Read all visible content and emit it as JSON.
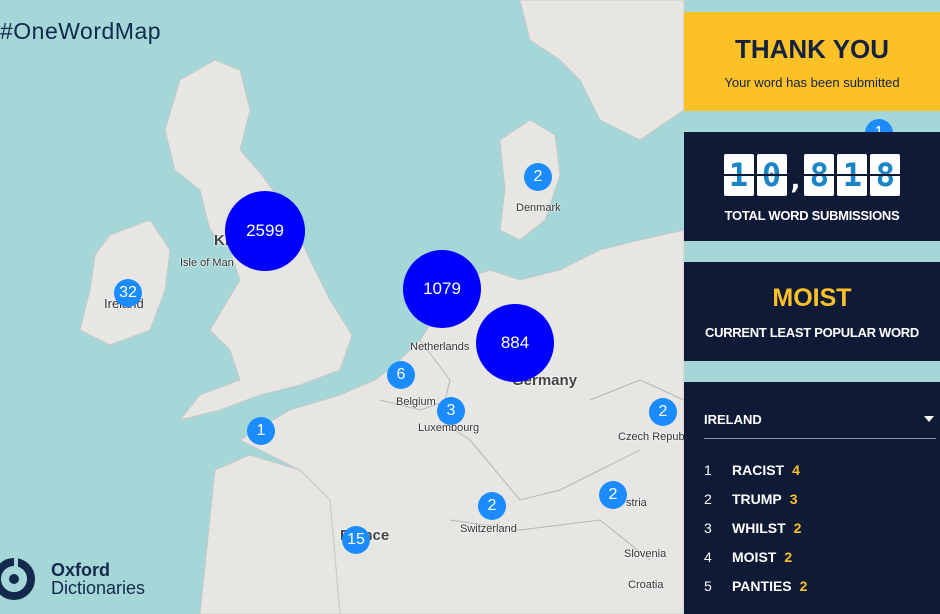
{
  "hashtag": "#OneWordMap",
  "logo": {
    "line1": "Oxford",
    "line2": "Dictionaries"
  },
  "thanks": {
    "title": "THANK YOU",
    "subtitle": "Your word has been submitted"
  },
  "total": {
    "digits": [
      "1",
      "0",
      "8",
      "1",
      "8"
    ],
    "separator": ",",
    "caption": "TOTAL WORD SUBMISSIONS"
  },
  "least": {
    "word": "MOIST",
    "caption": "CURRENT LEAST POPULAR WORD"
  },
  "country_select": {
    "selected": "IRELAND"
  },
  "top_words": [
    {
      "rank": "1",
      "word": "RACIST",
      "count": "4"
    },
    {
      "rank": "2",
      "word": "TRUMP",
      "count": "3"
    },
    {
      "rank": "3",
      "word": "WHILST",
      "count": "2"
    },
    {
      "rank": "4",
      "word": "MOIST",
      "count": "2"
    },
    {
      "rank": "5",
      "word": "PANTIES",
      "count": "2"
    }
  ],
  "map_labels": {
    "isle_of_man": "Isle of Man",
    "ireland": "Ireland",
    "uk": "Ki",
    "netherlands": "Netherlands",
    "belgium": "Belgium",
    "luxembourg": "Luxembourg",
    "germany": "Germany",
    "denmark": "Denmark",
    "czech": "Czech Republ",
    "austria": "stria",
    "switzerland": "Switzerland",
    "france": "France",
    "slovenia": "Slovenia",
    "croatia": "Croatia"
  },
  "markers": [
    "2599",
    "1079",
    "884",
    "32",
    "6",
    "3",
    "1",
    "2",
    "2",
    "2",
    "2",
    "15",
    "1"
  ],
  "colors": {
    "water": "#a5d6d8",
    "land": "#e8e6e3",
    "panel": "#0f1a37",
    "accent": "#fdc128",
    "marker_small": "#1a8cff",
    "marker_large": "#0000ff"
  }
}
